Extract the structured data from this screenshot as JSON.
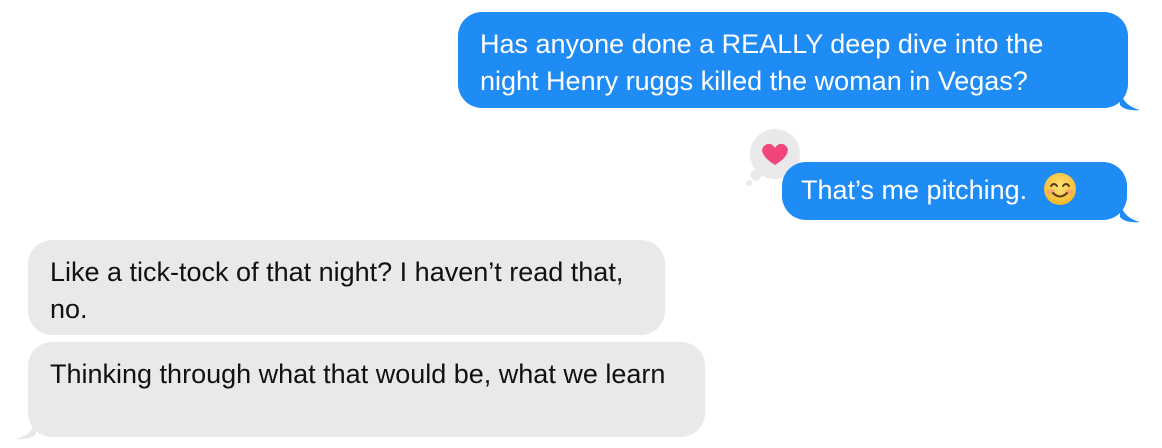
{
  "conversation": {
    "messages": [
      {
        "direction": "sent",
        "text": "Has anyone done a REALLY deep dive into the night Henry ruggs killed the woman in Vegas?"
      },
      {
        "direction": "sent",
        "text": "That’s me pitching.",
        "emoji": "smiling-face-emoji",
        "reaction": "heart-icon"
      },
      {
        "direction": "received",
        "text": "Like a tick-tock of that night? I haven’t read that, no."
      },
      {
        "direction": "received",
        "text": "Thinking through what that would be, what we learn"
      }
    ]
  },
  "colors": {
    "sent_bubble": "#1e8cf4",
    "received_bubble": "#e9e9eb",
    "reaction_bubble": "#e9e9eb",
    "heart": "#f0467a"
  }
}
